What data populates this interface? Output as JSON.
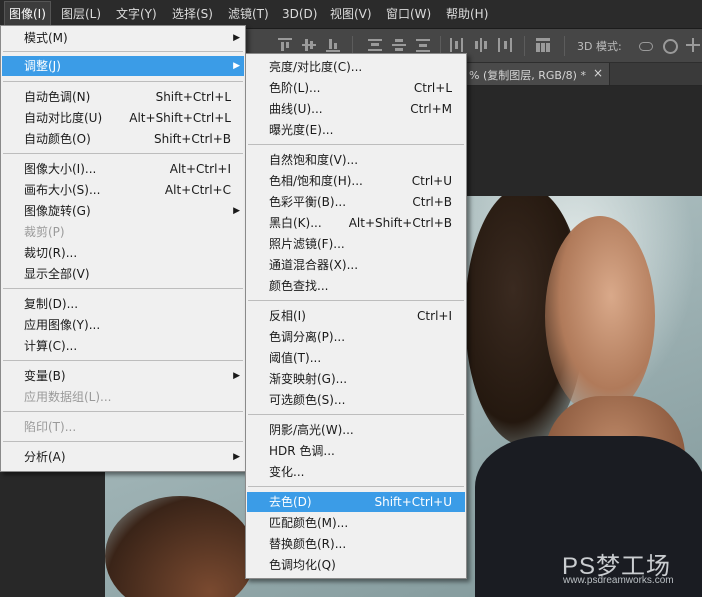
{
  "menubar": {
    "items": [
      {
        "label": "图像(I)"
      },
      {
        "label": "图层(L)"
      },
      {
        "label": "文字(Y)"
      },
      {
        "label": "选择(S)"
      },
      {
        "label": "滤镜(T)"
      },
      {
        "label": "3D(D)"
      },
      {
        "label": "视图(V)"
      },
      {
        "label": "窗口(W)"
      },
      {
        "label": "帮助(H)"
      }
    ]
  },
  "options_bar": {
    "mode_3d_label": "3D 模式:"
  },
  "document_tab": {
    "title": "% (复制图层, RGB/8) *",
    "close_glyph": "×"
  },
  "image_menu": {
    "items": [
      {
        "label": "模式(M)",
        "shortcut": "",
        "submenu": true
      },
      {
        "label": "调整(J)",
        "shortcut": "",
        "submenu": true
      },
      {
        "label": "自动色调(N)",
        "shortcut": "Shift+Ctrl+L"
      },
      {
        "label": "自动对比度(U)",
        "shortcut": "Alt+Shift+Ctrl+L"
      },
      {
        "label": "自动颜色(O)",
        "shortcut": "Shift+Ctrl+B"
      },
      {
        "label": "图像大小(I)...",
        "shortcut": "Alt+Ctrl+I"
      },
      {
        "label": "画布大小(S)...",
        "shortcut": "Alt+Ctrl+C"
      },
      {
        "label": "图像旋转(G)",
        "shortcut": "",
        "submenu": true
      },
      {
        "label": "裁剪(P)",
        "shortcut": "",
        "disabled": true
      },
      {
        "label": "裁切(R)...",
        "shortcut": ""
      },
      {
        "label": "显示全部(V)",
        "shortcut": ""
      },
      {
        "label": "复制(D)...",
        "shortcut": ""
      },
      {
        "label": "应用图像(Y)...",
        "shortcut": ""
      },
      {
        "label": "计算(C)...",
        "shortcut": ""
      },
      {
        "label": "变量(B)",
        "shortcut": "",
        "submenu": true
      },
      {
        "label": "应用数据组(L)...",
        "shortcut": "",
        "disabled": true
      },
      {
        "label": "陷印(T)...",
        "shortcut": "",
        "disabled": true
      },
      {
        "label": "分析(A)",
        "shortcut": "",
        "submenu": true
      }
    ]
  },
  "adjust_menu": {
    "items": [
      {
        "label": "亮度/对比度(C)...",
        "shortcut": ""
      },
      {
        "label": "色阶(L)...",
        "shortcut": "Ctrl+L"
      },
      {
        "label": "曲线(U)...",
        "shortcut": "Ctrl+M"
      },
      {
        "label": "曝光度(E)...",
        "shortcut": ""
      },
      {
        "label": "自然饱和度(V)...",
        "shortcut": ""
      },
      {
        "label": "色相/饱和度(H)...",
        "shortcut": "Ctrl+U"
      },
      {
        "label": "色彩平衡(B)...",
        "shortcut": "Ctrl+B"
      },
      {
        "label": "黑白(K)...",
        "shortcut": "Alt+Shift+Ctrl+B"
      },
      {
        "label": "照片滤镜(F)...",
        "shortcut": ""
      },
      {
        "label": "通道混合器(X)...",
        "shortcut": ""
      },
      {
        "label": "颜色查找...",
        "shortcut": ""
      },
      {
        "label": "反相(I)",
        "shortcut": "Ctrl+I"
      },
      {
        "label": "色调分离(P)...",
        "shortcut": ""
      },
      {
        "label": "阈值(T)...",
        "shortcut": ""
      },
      {
        "label": "渐变映射(G)...",
        "shortcut": ""
      },
      {
        "label": "可选颜色(S)...",
        "shortcut": ""
      },
      {
        "label": "阴影/高光(W)...",
        "shortcut": ""
      },
      {
        "label": "HDR 色调...",
        "shortcut": ""
      },
      {
        "label": "变化...",
        "shortcut": ""
      },
      {
        "label": "去色(D)",
        "shortcut": "Shift+Ctrl+U"
      },
      {
        "label": "匹配颜色(M)...",
        "shortcut": ""
      },
      {
        "label": "替换颜色(R)...",
        "shortcut": ""
      },
      {
        "label": "色调均化(Q)",
        "shortcut": ""
      }
    ]
  },
  "watermark": {
    "logo": "PS梦工场",
    "url": "www.psdreamworks.com"
  },
  "colors": {
    "highlight": "#3b9ce7",
    "menu_bg": "#f0f0f0",
    "menubar_bg": "#2b2b2b"
  }
}
